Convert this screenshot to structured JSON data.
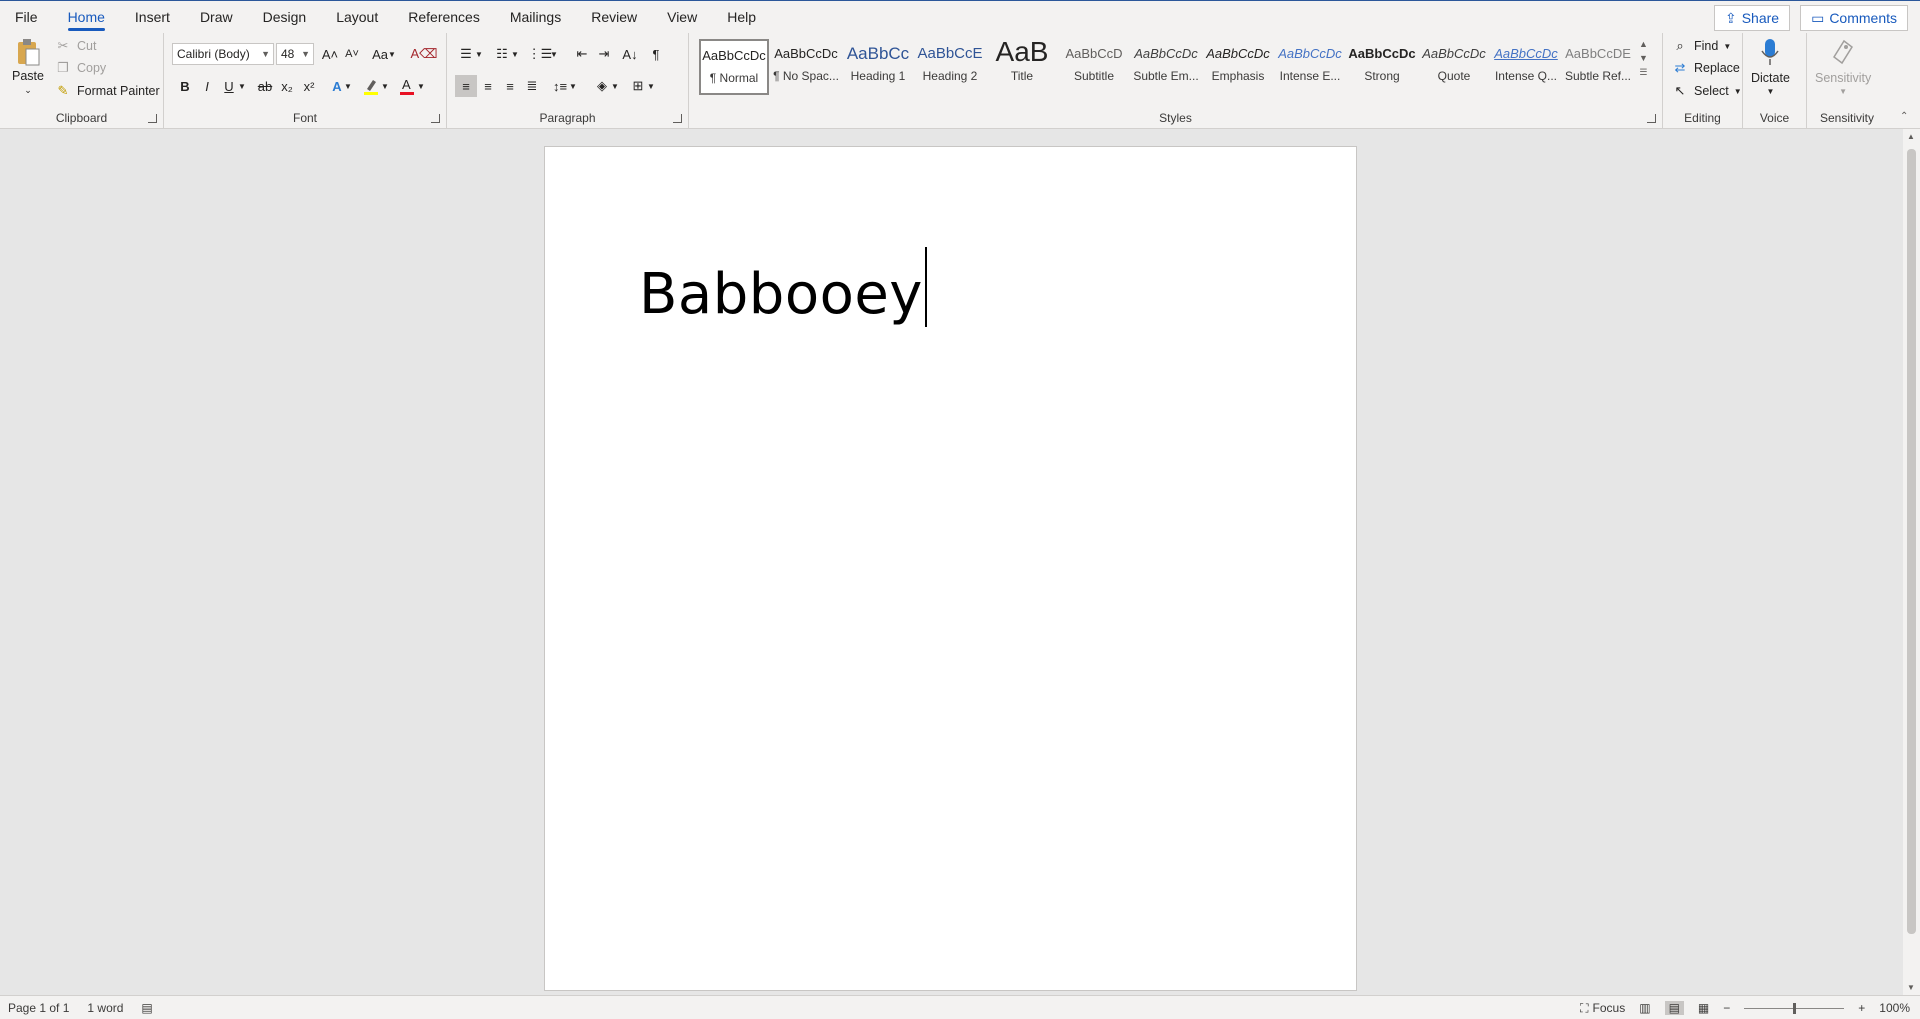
{
  "menu": {
    "tabs": [
      "File",
      "Home",
      "Insert",
      "Draw",
      "Design",
      "Layout",
      "References",
      "Mailings",
      "Review",
      "View",
      "Help"
    ],
    "active_tab": "Home",
    "share_label": "Share",
    "comments_label": "Comments"
  },
  "ribbon": {
    "clipboard": {
      "paste": "Paste",
      "cut": "Cut",
      "copy": "Copy",
      "format_painter": "Format Painter",
      "label": "Clipboard"
    },
    "font": {
      "name": "Calibri (Body)",
      "size": "48",
      "change_case": "Aa",
      "label": "Font"
    },
    "paragraph": {
      "label": "Paragraph"
    },
    "styles": {
      "label": "Styles",
      "items": [
        {
          "preview": "AaBbCcDc",
          "name": "¶ Normal"
        },
        {
          "preview": "AaBbCcDc",
          "name": "¶ No Spac..."
        },
        {
          "preview": "AaBbCc",
          "name": "Heading 1"
        },
        {
          "preview": "AaBbCcE",
          "name": "Heading 2"
        },
        {
          "preview": "AaB",
          "name": "Title"
        },
        {
          "preview": "AaBbCcD",
          "name": "Subtitle"
        },
        {
          "preview": "AaBbCcDc",
          "name": "Subtle Em..."
        },
        {
          "preview": "AaBbCcDc",
          "name": "Emphasis"
        },
        {
          "preview": "AaBbCcDc",
          "name": "Intense E..."
        },
        {
          "preview": "AaBbCcDc",
          "name": "Strong"
        },
        {
          "preview": "AaBbCcDc",
          "name": "Quote"
        },
        {
          "preview": "AaBbCcDc",
          "name": "Intense Q..."
        },
        {
          "preview": "AaBbCcDE",
          "name": "Subtle Ref..."
        }
      ]
    },
    "editing": {
      "find": "Find",
      "replace": "Replace",
      "select": "Select",
      "label": "Editing"
    },
    "voice": {
      "dictate": "Dictate",
      "label": "Voice"
    },
    "sensitivity": {
      "button": "Sensitivity",
      "label": "Sensitivity"
    }
  },
  "document": {
    "text": "Babbooey"
  },
  "status": {
    "page": "Page 1 of 1",
    "words": "1 word",
    "focus": "Focus",
    "zoom": "100%"
  }
}
